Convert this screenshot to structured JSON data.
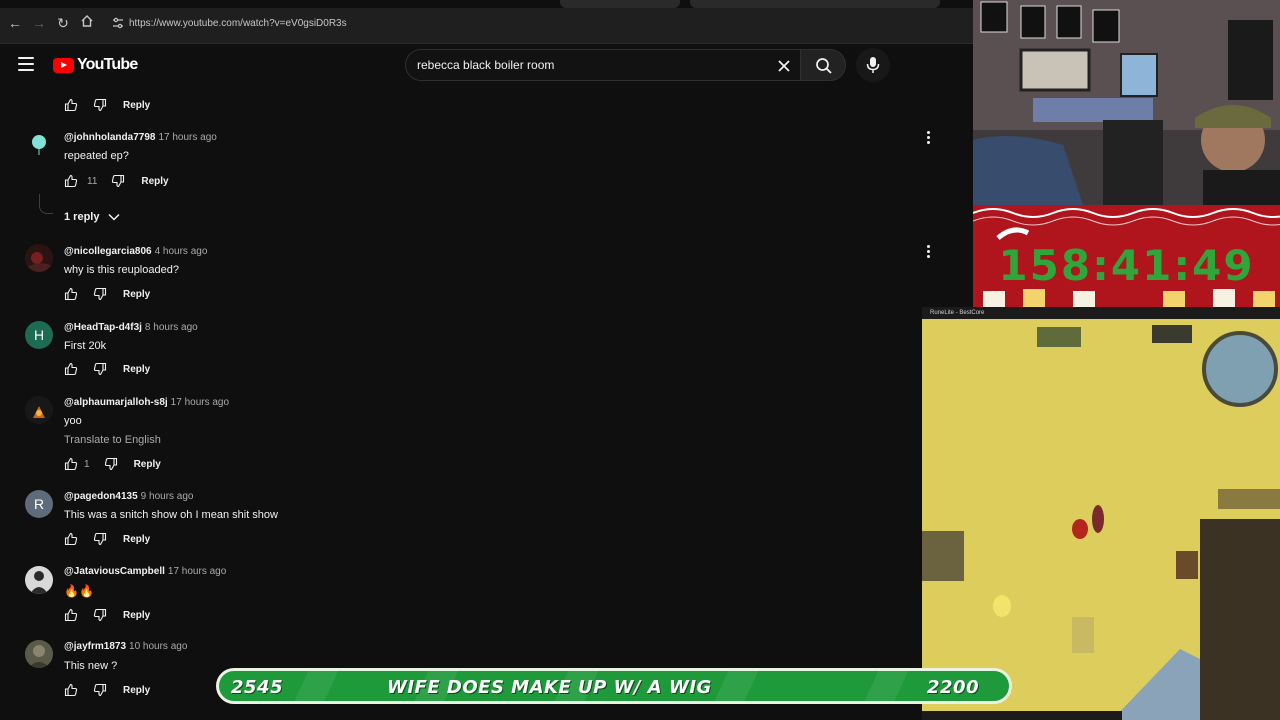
{
  "browser": {
    "url": "https://www.youtube.com/watch?v=eV0gsiD0R3s"
  },
  "youtube": {
    "logo_text": "YouTube",
    "search_query": "rebecca black boiler room"
  },
  "comments": {
    "reply_label": "Reply",
    "translate_label": "Translate to English",
    "items": [
      {
        "user": "@johnholanda7798",
        "time": "17 hours ago",
        "text": "repeated ep?",
        "likes": "11",
        "replies": "1 reply"
      },
      {
        "user": "@nicollegarcia806",
        "time": "4 hours ago",
        "text": "why is this reuploaded?",
        "likes": ""
      },
      {
        "user": "@HeadTap-d4f3j",
        "time": "8 hours ago",
        "text": "First 20k",
        "likes": "",
        "avatar_letter": "H",
        "avatar_color": "#1e6b53"
      },
      {
        "user": "@alphaumarjalloh-s8j",
        "time": "17 hours ago",
        "text": "yoo",
        "likes": "1"
      },
      {
        "user": "@pagedon4135",
        "time": "9 hours ago",
        "text": "This was a snitch show oh I mean shit show",
        "likes": "",
        "avatar_letter": "R",
        "avatar_color": "#5e6b7a"
      },
      {
        "user": "@JataviousCampbell",
        "time": "17 hours ago",
        "text": "🔥🔥",
        "likes": ""
      },
      {
        "user": "@jayfrm1873",
        "time": "10 hours ago",
        "text": "This new ?",
        "likes": ""
      }
    ]
  },
  "overlay": {
    "timer": "158:41:49",
    "banner_left": "2545",
    "banner_center": "WIFE DOES MAKE UP W/ A WIG",
    "banner_right": "2200",
    "game_title": "RuneLite - BestCore"
  },
  "colors": {
    "yt_red": "#ff0000",
    "banner_green": "#1e9a3a",
    "timer_red": "#b0141c",
    "timer_digits": "#2fa53a"
  }
}
